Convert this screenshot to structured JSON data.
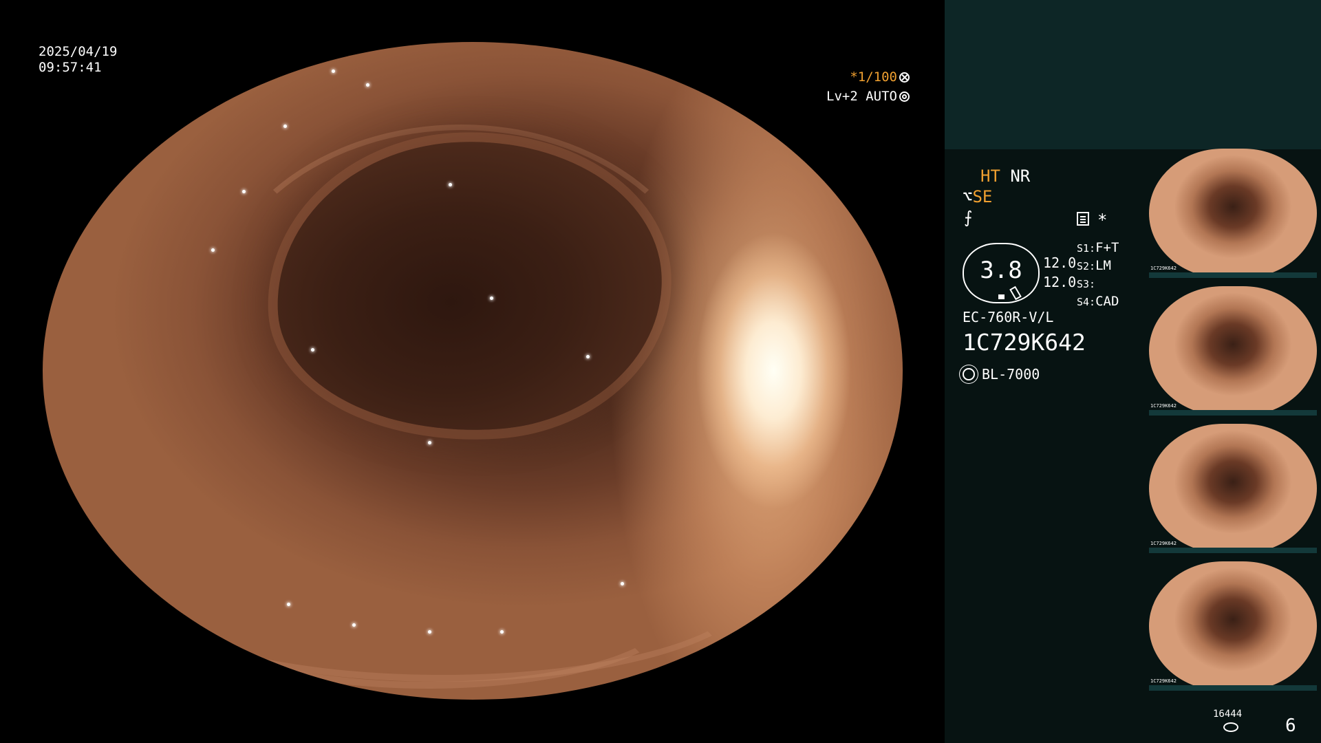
{
  "osd": {
    "date": "2025/04/19",
    "time": "09:57:41",
    "shutter": "*1/100",
    "level": "Lv+2 AUTO"
  },
  "panel": {
    "ht": "HT",
    "nr": "NR",
    "se": "SE",
    "star": "*",
    "gauge_value": "3.8",
    "num_a": "12.0",
    "num_b": "12.0",
    "slots": [
      {
        "key": "S1:",
        "val": "F+T"
      },
      {
        "key": "S2:",
        "val": "LM"
      },
      {
        "key": "S3:",
        "val": ""
      },
      {
        "key": "S4:",
        "val": "CAD"
      }
    ],
    "model": "EC-760R-V/L",
    "serial": "1C729K642",
    "lamp": "BL-7000",
    "count": "16444",
    "page": "6"
  },
  "thumbnails": [
    {
      "label": "1C729K642"
    },
    {
      "label": "1C729K642"
    },
    {
      "label": "1C729K642"
    },
    {
      "label": "1C729K642"
    }
  ],
  "colors": {
    "accent_orange": "#f0a030",
    "panel_bg": "#071312",
    "panel_top_bg": "#0d2626"
  }
}
